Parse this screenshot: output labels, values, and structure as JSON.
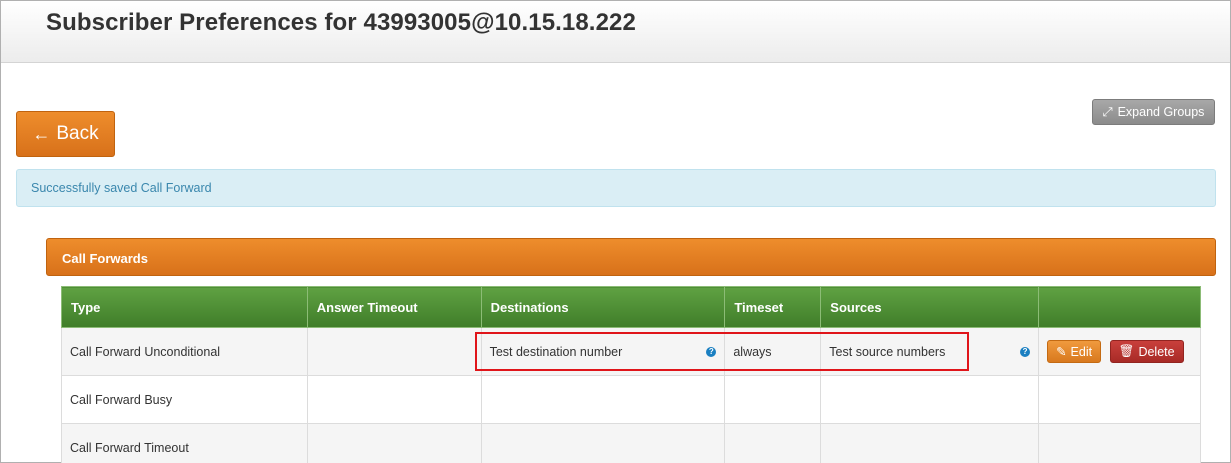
{
  "header": {
    "title": "Subscriber Preferences for 43993005@10.15.18.222"
  },
  "toolbar": {
    "back_label": "Back",
    "expand_groups_label": "Expand Groups"
  },
  "alert": {
    "message": "Successfully saved Call Forward"
  },
  "panel": {
    "title": "Call Forwards"
  },
  "table": {
    "columns": [
      "Type",
      "Answer Timeout",
      "Destinations",
      "Timeset",
      "Sources",
      ""
    ],
    "rows": [
      {
        "type": "Call Forward Unconditional",
        "answer_timeout": "",
        "destinations": "Test destination number",
        "timeset": "always",
        "sources": "Test source numbers",
        "edit_label": "Edit",
        "delete_label": "Delete"
      },
      {
        "type": "Call Forward Busy",
        "answer_timeout": "",
        "destinations": "",
        "timeset": "",
        "sources": ""
      },
      {
        "type": "Call Forward Timeout",
        "answer_timeout": "",
        "destinations": "",
        "timeset": "",
        "sources": ""
      }
    ]
  },
  "icons": {
    "back": "arrow-left-icon",
    "expand": "expand-icon",
    "help": "question-circle-icon",
    "edit": "edit-icon",
    "delete": "trash-icon"
  },
  "colors": {
    "accent_orange": "#e07f22",
    "table_header_green": "#4a8a31",
    "alert_bg": "#daeef5",
    "alert_text": "#3a87ad",
    "delete_red": "#b8322e",
    "highlight_red": "#e0151a"
  }
}
